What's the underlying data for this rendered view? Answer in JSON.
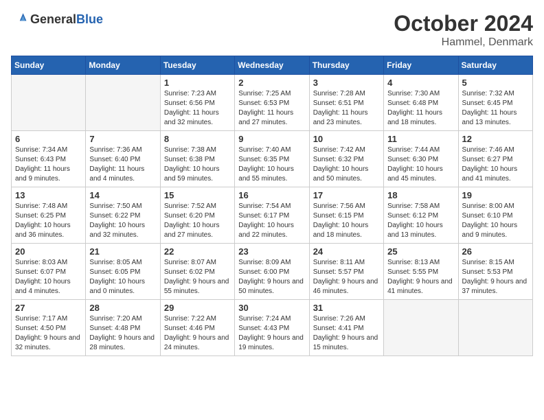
{
  "header": {
    "logo_general": "General",
    "logo_blue": "Blue",
    "month_title": "October 2024",
    "location": "Hammel, Denmark"
  },
  "days_of_week": [
    "Sunday",
    "Monday",
    "Tuesday",
    "Wednesday",
    "Thursday",
    "Friday",
    "Saturday"
  ],
  "weeks": [
    [
      {
        "day": "",
        "empty": true
      },
      {
        "day": "",
        "empty": true
      },
      {
        "day": "1",
        "sunrise": "Sunrise: 7:23 AM",
        "sunset": "Sunset: 6:56 PM",
        "daylight": "Daylight: 11 hours and 32 minutes."
      },
      {
        "day": "2",
        "sunrise": "Sunrise: 7:25 AM",
        "sunset": "Sunset: 6:53 PM",
        "daylight": "Daylight: 11 hours and 27 minutes."
      },
      {
        "day": "3",
        "sunrise": "Sunrise: 7:28 AM",
        "sunset": "Sunset: 6:51 PM",
        "daylight": "Daylight: 11 hours and 23 minutes."
      },
      {
        "day": "4",
        "sunrise": "Sunrise: 7:30 AM",
        "sunset": "Sunset: 6:48 PM",
        "daylight": "Daylight: 11 hours and 18 minutes."
      },
      {
        "day": "5",
        "sunrise": "Sunrise: 7:32 AM",
        "sunset": "Sunset: 6:45 PM",
        "daylight": "Daylight: 11 hours and 13 minutes."
      }
    ],
    [
      {
        "day": "6",
        "sunrise": "Sunrise: 7:34 AM",
        "sunset": "Sunset: 6:43 PM",
        "daylight": "Daylight: 11 hours and 9 minutes."
      },
      {
        "day": "7",
        "sunrise": "Sunrise: 7:36 AM",
        "sunset": "Sunset: 6:40 PM",
        "daylight": "Daylight: 11 hours and 4 minutes."
      },
      {
        "day": "8",
        "sunrise": "Sunrise: 7:38 AM",
        "sunset": "Sunset: 6:38 PM",
        "daylight": "Daylight: 10 hours and 59 minutes."
      },
      {
        "day": "9",
        "sunrise": "Sunrise: 7:40 AM",
        "sunset": "Sunset: 6:35 PM",
        "daylight": "Daylight: 10 hours and 55 minutes."
      },
      {
        "day": "10",
        "sunrise": "Sunrise: 7:42 AM",
        "sunset": "Sunset: 6:32 PM",
        "daylight": "Daylight: 10 hours and 50 minutes."
      },
      {
        "day": "11",
        "sunrise": "Sunrise: 7:44 AM",
        "sunset": "Sunset: 6:30 PM",
        "daylight": "Daylight: 10 hours and 45 minutes."
      },
      {
        "day": "12",
        "sunrise": "Sunrise: 7:46 AM",
        "sunset": "Sunset: 6:27 PM",
        "daylight": "Daylight: 10 hours and 41 minutes."
      }
    ],
    [
      {
        "day": "13",
        "sunrise": "Sunrise: 7:48 AM",
        "sunset": "Sunset: 6:25 PM",
        "daylight": "Daylight: 10 hours and 36 minutes."
      },
      {
        "day": "14",
        "sunrise": "Sunrise: 7:50 AM",
        "sunset": "Sunset: 6:22 PM",
        "daylight": "Daylight: 10 hours and 32 minutes."
      },
      {
        "day": "15",
        "sunrise": "Sunrise: 7:52 AM",
        "sunset": "Sunset: 6:20 PM",
        "daylight": "Daylight: 10 hours and 27 minutes."
      },
      {
        "day": "16",
        "sunrise": "Sunrise: 7:54 AM",
        "sunset": "Sunset: 6:17 PM",
        "daylight": "Daylight: 10 hours and 22 minutes."
      },
      {
        "day": "17",
        "sunrise": "Sunrise: 7:56 AM",
        "sunset": "Sunset: 6:15 PM",
        "daylight": "Daylight: 10 hours and 18 minutes."
      },
      {
        "day": "18",
        "sunrise": "Sunrise: 7:58 AM",
        "sunset": "Sunset: 6:12 PM",
        "daylight": "Daylight: 10 hours and 13 minutes."
      },
      {
        "day": "19",
        "sunrise": "Sunrise: 8:00 AM",
        "sunset": "Sunset: 6:10 PM",
        "daylight": "Daylight: 10 hours and 9 minutes."
      }
    ],
    [
      {
        "day": "20",
        "sunrise": "Sunrise: 8:03 AM",
        "sunset": "Sunset: 6:07 PM",
        "daylight": "Daylight: 10 hours and 4 minutes."
      },
      {
        "day": "21",
        "sunrise": "Sunrise: 8:05 AM",
        "sunset": "Sunset: 6:05 PM",
        "daylight": "Daylight: 10 hours and 0 minutes."
      },
      {
        "day": "22",
        "sunrise": "Sunrise: 8:07 AM",
        "sunset": "Sunset: 6:02 PM",
        "daylight": "Daylight: 9 hours and 55 minutes."
      },
      {
        "day": "23",
        "sunrise": "Sunrise: 8:09 AM",
        "sunset": "Sunset: 6:00 PM",
        "daylight": "Daylight: 9 hours and 50 minutes."
      },
      {
        "day": "24",
        "sunrise": "Sunrise: 8:11 AM",
        "sunset": "Sunset: 5:57 PM",
        "daylight": "Daylight: 9 hours and 46 minutes."
      },
      {
        "day": "25",
        "sunrise": "Sunrise: 8:13 AM",
        "sunset": "Sunset: 5:55 PM",
        "daylight": "Daylight: 9 hours and 41 minutes."
      },
      {
        "day": "26",
        "sunrise": "Sunrise: 8:15 AM",
        "sunset": "Sunset: 5:53 PM",
        "daylight": "Daylight: 9 hours and 37 minutes."
      }
    ],
    [
      {
        "day": "27",
        "sunrise": "Sunrise: 7:17 AM",
        "sunset": "Sunset: 4:50 PM",
        "daylight": "Daylight: 9 hours and 32 minutes."
      },
      {
        "day": "28",
        "sunrise": "Sunrise: 7:20 AM",
        "sunset": "Sunset: 4:48 PM",
        "daylight": "Daylight: 9 hours and 28 minutes."
      },
      {
        "day": "29",
        "sunrise": "Sunrise: 7:22 AM",
        "sunset": "Sunset: 4:46 PM",
        "daylight": "Daylight: 9 hours and 24 minutes."
      },
      {
        "day": "30",
        "sunrise": "Sunrise: 7:24 AM",
        "sunset": "Sunset: 4:43 PM",
        "daylight": "Daylight: 9 hours and 19 minutes."
      },
      {
        "day": "31",
        "sunrise": "Sunrise: 7:26 AM",
        "sunset": "Sunset: 4:41 PM",
        "daylight": "Daylight: 9 hours and 15 minutes."
      },
      {
        "day": "",
        "empty": true
      },
      {
        "day": "",
        "empty": true
      }
    ]
  ]
}
